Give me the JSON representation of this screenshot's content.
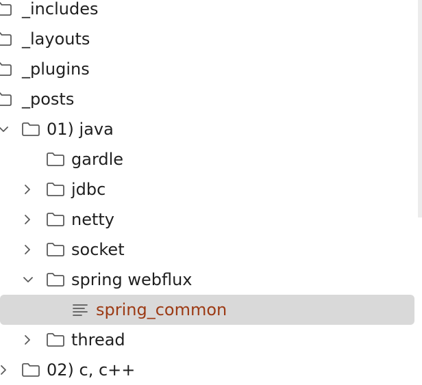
{
  "tree": {
    "items": [
      {
        "label": "_includes",
        "type": "folder",
        "chevron": "none"
      },
      {
        "label": "_layouts",
        "type": "folder",
        "chevron": "none"
      },
      {
        "label": "_plugins",
        "type": "folder",
        "chevron": "none"
      },
      {
        "label": "_posts",
        "type": "folder",
        "chevron": "none"
      },
      {
        "label": "01) java",
        "type": "folder",
        "chevron": "expanded"
      },
      {
        "label": "gardle",
        "type": "folder",
        "chevron": "none"
      },
      {
        "label": "jdbc",
        "type": "folder",
        "chevron": "collapsed"
      },
      {
        "label": "netty",
        "type": "folder",
        "chevron": "collapsed"
      },
      {
        "label": "socket",
        "type": "folder",
        "chevron": "collapsed"
      },
      {
        "label": "spring webflux",
        "type": "folder",
        "chevron": "expanded"
      },
      {
        "label": "spring_common",
        "type": "file",
        "chevron": "none",
        "selected": true
      },
      {
        "label": "thread",
        "type": "folder",
        "chevron": "collapsed"
      },
      {
        "label": "02) c, c++",
        "type": "folder",
        "chevron": "collapsed"
      }
    ]
  },
  "colors": {
    "selected_row": "#d9d9d9",
    "file_label": "#9c3a14",
    "text": "#1f1f1f",
    "icon_stroke": "#5a5a5a"
  }
}
